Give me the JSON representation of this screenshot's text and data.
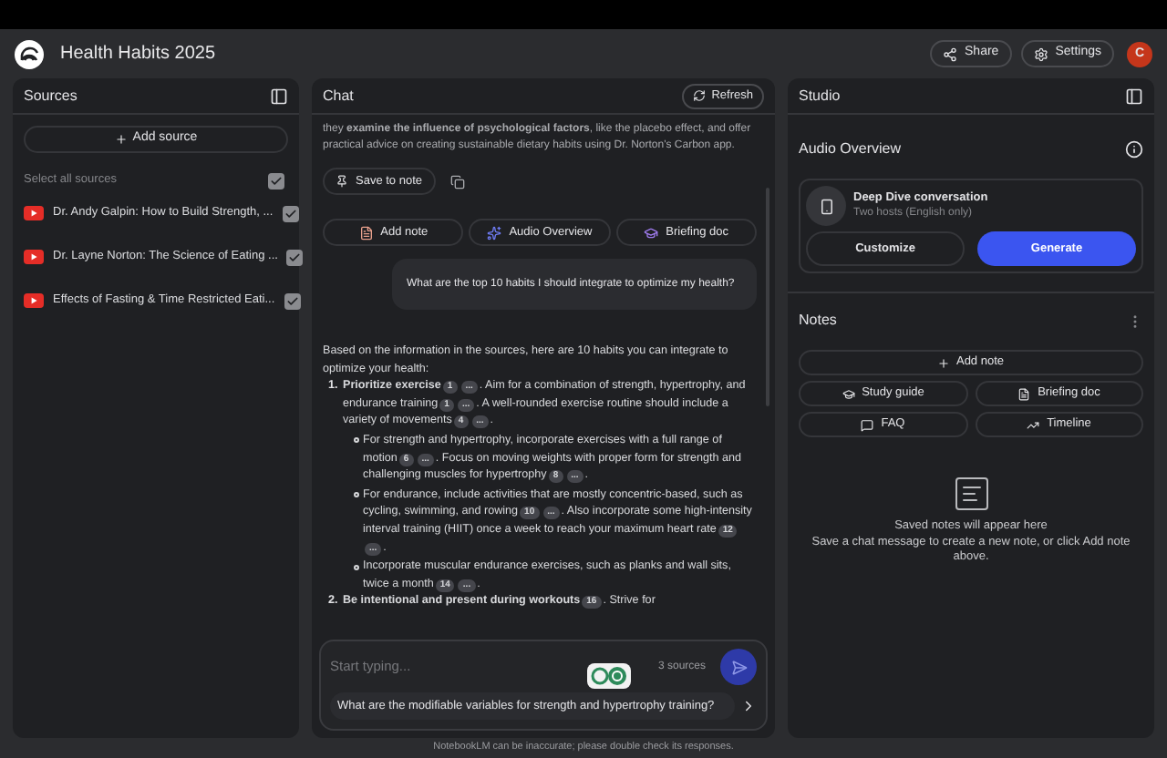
{
  "app": {
    "title": "Health Habits 2025",
    "avatar": "C"
  },
  "header_buttons": [
    {
      "kind": "share",
      "label": "Share"
    },
    {
      "kind": "settings",
      "label": "Settings"
    }
  ],
  "sources": {
    "title": "Sources",
    "add_button": "Add source",
    "select_all": {
      "label": "Select all sources",
      "checked": true
    },
    "items": [
      {
        "title": "Dr. Andy Galpin: How to Build Strength, ...",
        "checked": true
      },
      {
        "title": "Dr. Layne Norton: The Science of Eating ...",
        "checked": true
      },
      {
        "title": "Effects of Fasting & Time Restricted Eati...",
        "checked": true
      }
    ]
  },
  "chat": {
    "title": "Chat",
    "refresh": "Refresh",
    "previous_answer": "they **examine the influence of psychological factors**, like the placebo effect, and offer practical advice on creating sustainable dietary habits using Dr. Norton's Carbon app.",
    "save_to_note": "Save to note",
    "actions": [
      {
        "kind": "note",
        "label": "Add note"
      },
      {
        "kind": "audio",
        "label": "Audio Overview"
      },
      {
        "kind": "briefing",
        "label": "Briefing doc"
      }
    ],
    "question": "What are the top 10 habits I should integrate to optimize my health?",
    "answer": {
      "intro": "Based on the information in the sources, here are 10 habits you can integrate to optimize your health:",
      "items": [
        {
          "number": "1.",
          "segments": [
            {
              "text": "**Prioritize exercise**"
            },
            {
              "cite": "1"
            },
            {
              "cite": "..."
            },
            {
              "text": ". Aim for a combination of strength, hypertrophy, and endurance training"
            },
            {
              "cite": "1"
            },
            {
              "cite": "..."
            },
            {
              "text": ". A well-rounded exercise routine should include a variety of movements"
            },
            {
              "cite": "4"
            },
            {
              "cite": "..."
            },
            {
              "text": "."
            }
          ],
          "children": [
            {
              "segments": [
                {
                  "text": "For strength and hypertrophy, incorporate exercises with a full range of motion"
                },
                {
                  "cite": "6"
                },
                {
                  "cite": "..."
                },
                {
                  "text": ". Focus on moving weights with proper form for strength and challenging muscles for hypertrophy"
                },
                {
                  "cite": "8"
                },
                {
                  "cite": "..."
                },
                {
                  "text": "."
                }
              ]
            },
            {
              "segments": [
                {
                  "text": "For endurance, include activities that are mostly concentric-based, such as cycling, swimming, and rowing"
                },
                {
                  "cite": "10"
                },
                {
                  "cite": "..."
                },
                {
                  "text": ". Also incorporate some high-intensity interval training (HIIT) once a week to reach your maximum heart rate"
                },
                {
                  "cite": "12"
                },
                {
                  "cite": "..."
                },
                {
                  "text": "."
                }
              ]
            },
            {
              "segments": [
                {
                  "text": "Incorporate muscular endurance exercises, such as planks and wall sits, twice a month"
                },
                {
                  "cite": "14"
                },
                {
                  "cite": "..."
                },
                {
                  "text": "."
                }
              ]
            }
          ]
        },
        {
          "number": "2.",
          "segments": [
            {
              "text": "**Be intentional and present during workouts**"
            },
            {
              "cite": "16"
            },
            {
              "text": ". Strive for"
            }
          ]
        }
      ]
    },
    "input": {
      "placeholder": "Start typing...",
      "source_count": "3 sources",
      "suggestion": "What are the modifiable variables for strength and hypertrophy training?"
    }
  },
  "studio": {
    "title": "Studio",
    "audio": {
      "title": "Audio Overview",
      "name": "Deep Dive conversation",
      "subtitle": "Two hosts (English only)",
      "customize": "Customize",
      "generate": "Generate"
    },
    "notes": {
      "title": "Notes",
      "add_button": "Add note",
      "actions": [
        {
          "kind": "study",
          "label": "Study guide"
        },
        {
          "kind": "briefing",
          "label": "Briefing doc"
        },
        {
          "kind": "faq",
          "label": "FAQ"
        },
        {
          "kind": "timeline",
          "label": "Timeline"
        }
      ],
      "empty_title": "Saved notes will appear here",
      "empty_text": "Save a chat message to create a new note, or click Add note above."
    }
  },
  "footer": "NotebookLM can be inaccurate; please double check its responses."
}
